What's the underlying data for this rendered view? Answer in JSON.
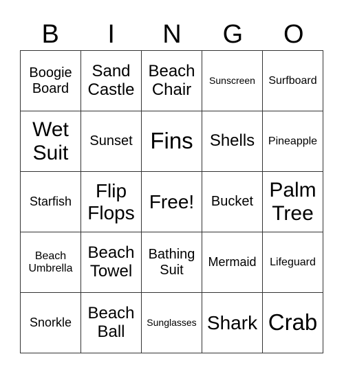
{
  "header": [
    "B",
    "I",
    "N",
    "G",
    "O"
  ],
  "cells": [
    "Boogie Board",
    "Sand Castle",
    "Beach Chair",
    "Sunscreen",
    "Surfboard",
    "Wet Suit",
    "Sunset",
    "Fins",
    "Shells",
    "Pineapple",
    "Starfish",
    "Flip Flops",
    "Free!",
    "Bucket",
    "Palm Tree",
    "Beach Umbrella",
    "Beach Towel",
    "Bathing Suit",
    "Mermaid",
    "Lifeguard",
    "Snorkle",
    "Beach Ball",
    "Sunglasses",
    "Shark",
    "Crab"
  ]
}
